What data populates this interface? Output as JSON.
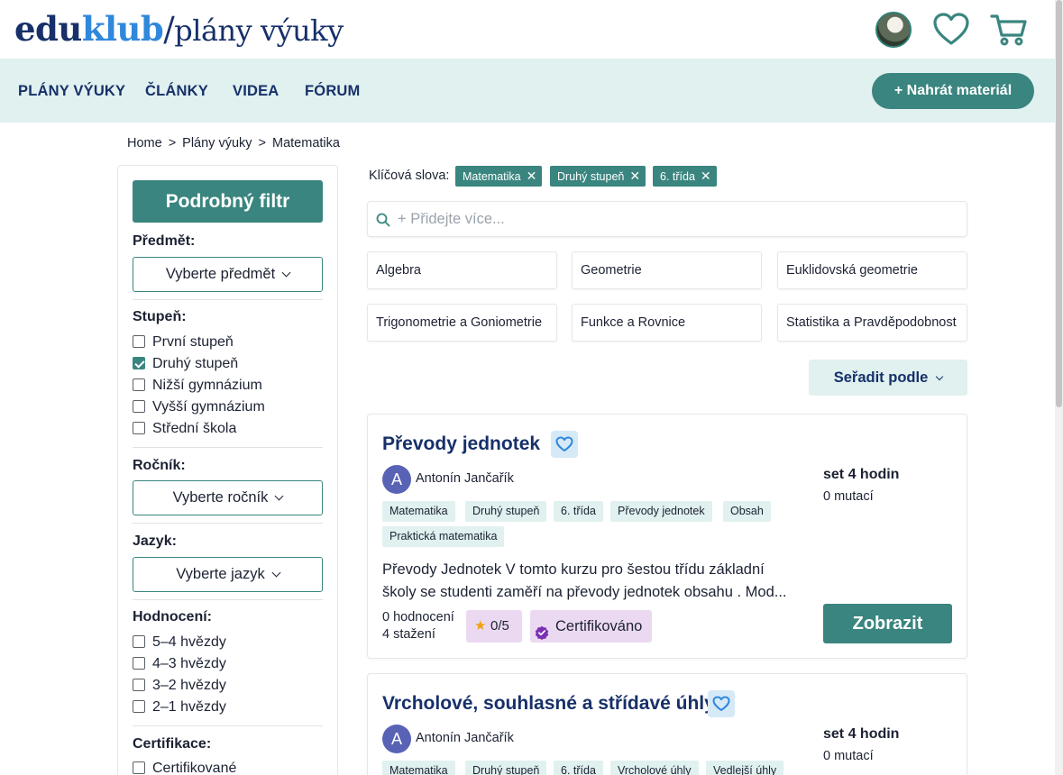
{
  "brand": {
    "edu": "edu",
    "klub": "klub",
    "slash": "/",
    "subtitle": "plány výuky"
  },
  "header_icons": [
    "user-avatar",
    "heart-icon",
    "cart-icon"
  ],
  "nav": {
    "items": [
      "PLÁNY VÝUKY",
      "ČLÁNKY",
      "VIDEA",
      "FÓRUM"
    ],
    "upload_label": "+ Nahrát materiál"
  },
  "breadcrumb": [
    "Home",
    "Plány výuky",
    "Matematika"
  ],
  "breadcrumb_separator": ">",
  "sidebar": {
    "filter_button": "Podrobný filtr",
    "subject": {
      "label": "Předmět:",
      "placeholder": "Vyberte předmět"
    },
    "level": {
      "label": "Stupeň:",
      "options": [
        {
          "label": "První stupeň",
          "checked": false
        },
        {
          "label": "Druhý stupeň",
          "checked": true
        },
        {
          "label": "Nižší gymnázium",
          "checked": false
        },
        {
          "label": "Vyšší gymnázium",
          "checked": false
        },
        {
          "label": "Střední škola",
          "checked": false
        }
      ]
    },
    "grade": {
      "label": "Ročník:",
      "placeholder": "Vyberte ročník"
    },
    "language": {
      "label": "Jazyk:",
      "placeholder": "Vyberte jazyk"
    },
    "rating": {
      "label": "Hodnocení:",
      "options": [
        {
          "label": "5–4 hvězdy",
          "checked": false
        },
        {
          "label": "4–3 hvězdy",
          "checked": false
        },
        {
          "label": "3–2 hvězdy",
          "checked": false
        },
        {
          "label": "2–1 hvězdy",
          "checked": false
        }
      ]
    },
    "certification": {
      "label": "Certifikace:",
      "options": [
        {
          "label": "Certifikované",
          "checked": false
        }
      ]
    }
  },
  "keywords": {
    "label": "Klíčová slova:",
    "chips": [
      "Matematika",
      "Druhý stupeň",
      "6. třída"
    ],
    "remove_glyph": "✕"
  },
  "search": {
    "placeholder": "+ Přidejte více..."
  },
  "topics": [
    "Algebra",
    "Geometrie",
    "Euklidovská geometrie",
    "Trigonometrie a Goniometrie",
    "Funkce a Rovnice",
    "Statistika a Pravděpodobnost"
  ],
  "sort": {
    "label": "Seřadit podle"
  },
  "cards": [
    {
      "title": "Převody jednotek",
      "author_initial": "A",
      "author": "Antonín Jančařík",
      "tags": [
        "Matematika",
        "Druhý stupeň",
        "6. třída",
        "Převody jednotek",
        "Obsah",
        "Praktická matematika"
      ],
      "description": "Převody Jednotek V tomto kurzu pro šestou třídu základní školy se studenti zaměří na převody jednotek obsahu . Mod...",
      "ratings_count": "0 hodnocení",
      "downloads": "4 stažení",
      "rating_value": "0/5",
      "certified": "Certifikováno",
      "set_title": "set 4 hodin",
      "mutations": "0 mutací",
      "view_button": "Zobrazit"
    },
    {
      "title": "Vrcholové, souhlasné a střídavé úhly",
      "author_initial": "A",
      "author": "Antonín Jančařík",
      "tags": [
        "Matematika",
        "Druhý stupeň",
        "6. třída",
        "Vrcholové úhly",
        "Vedlejší úhly"
      ],
      "set_title": "set 4 hodin",
      "mutations": "0 mutací"
    }
  ],
  "colors": {
    "navy": "#17306a",
    "teal": "#3a857f",
    "mint": "#e0f1ef",
    "accent_blue": "#2f88db",
    "star": "#f2a20d",
    "cert_purple": "#7b2fb5"
  }
}
